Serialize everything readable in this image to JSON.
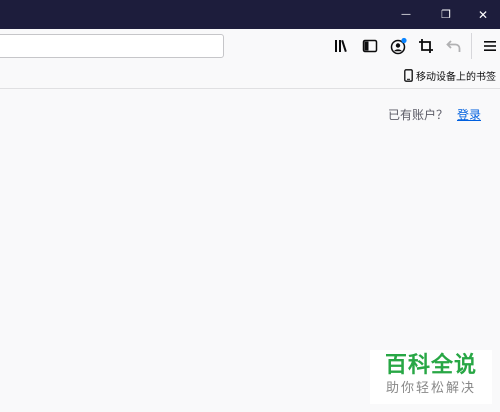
{
  "window": {
    "minimize_glyph": "—",
    "restore_glyph": "❐",
    "close_glyph": "✕"
  },
  "toolbar": {
    "url_value": "",
    "url_placeholder": "",
    "icons": [
      "library-icon",
      "sidebar-icon",
      "account-icon",
      "screenshot-icon",
      "undo-icon",
      "menu-icon"
    ]
  },
  "bookmarks": {
    "mobile_label": "移动设备上的书签"
  },
  "content": {
    "has_account_text": "已有账户？",
    "login_link": "登录"
  },
  "watermark": {
    "title": "百科全说",
    "subtitle": "助你轻松解决"
  },
  "colors": {
    "titlebar": "#1d1d3c",
    "link": "#0060df",
    "account_badge": "#0a84ff",
    "watermark_green": "#28a745"
  }
}
